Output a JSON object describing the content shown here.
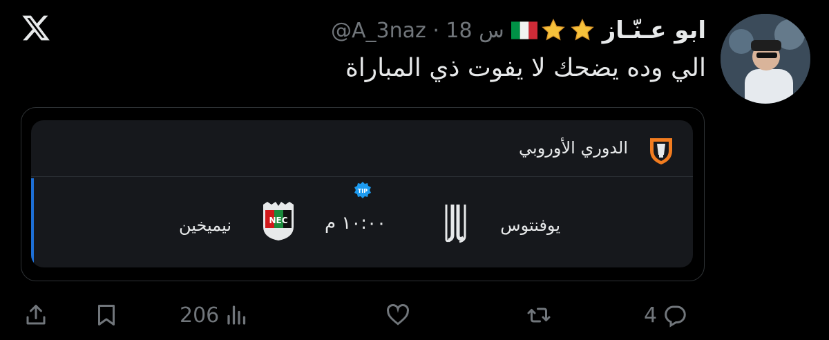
{
  "app": {
    "logo_icon": "x-logo-icon"
  },
  "tweet": {
    "display_name": "ابو عـنّـاز",
    "badges": [
      "italy-flag-icon",
      "star-icon",
      "star-icon"
    ],
    "handle_time": "@A_3naz · 18 س",
    "text": "الي وده يضحك لا يفوت ذي المباراة",
    "avatar_icon": "user-avatar"
  },
  "card": {
    "league": "الدوري الأوروبي",
    "league_icon": "europa-league-icon",
    "home_team": "يوفنتوس",
    "home_icon": "juventus-logo-icon",
    "time": "١٠:٠٠ م",
    "tip_icon": "tip-badge-icon",
    "away_team": "نيميخين",
    "away_icon": "nec-nijmegen-logo-icon",
    "accent_color": "#1d6fd6"
  },
  "actions": {
    "reply_count": "4",
    "retweet_count": "",
    "like_count": "",
    "views_count": "206"
  }
}
